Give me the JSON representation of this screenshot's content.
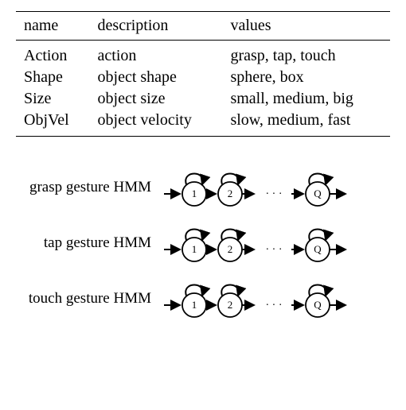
{
  "table": {
    "headers": [
      "name",
      "description",
      "values"
    ],
    "rows": [
      {
        "name": "Action",
        "description": "action",
        "values": "grasp, tap, touch"
      },
      {
        "name": "Shape",
        "description": "object shape",
        "values": "sphere, box"
      },
      {
        "name": "Size",
        "description": "object size",
        "values": "small, medium, big"
      },
      {
        "name": "ObjVel",
        "description": "object velocity",
        "values": "slow, medium, fast"
      }
    ]
  },
  "diagram": {
    "rows": [
      {
        "label": "grasp gesture HMM"
      },
      {
        "label": "tap gesture HMM"
      },
      {
        "label": "touch gesture HMM"
      }
    ],
    "states": {
      "s1": "1",
      "s2": "2",
      "dots": "· · ·",
      "sQ": "Q"
    }
  },
  "chart_data": {
    "type": "table",
    "title": "",
    "columns": [
      "name",
      "description",
      "values"
    ],
    "rows": [
      [
        "Action",
        "action",
        "grasp, tap, touch"
      ],
      [
        "Shape",
        "object shape",
        "sphere, box"
      ],
      [
        "Size",
        "object size",
        "small, medium, big"
      ],
      [
        "ObjVel",
        "object velocity",
        "slow, medium, fast"
      ]
    ]
  }
}
